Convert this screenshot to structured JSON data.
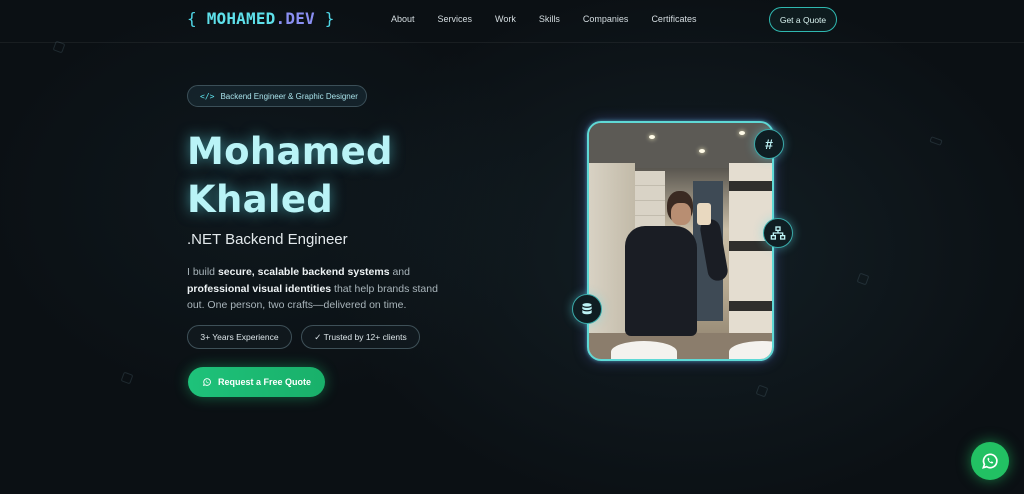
{
  "brand": {
    "open_brace": "{",
    "name": "MOHAMED",
    "suffix": ".DEV",
    "close_brace": "}"
  },
  "nav": {
    "items": [
      "About",
      "Services",
      "Work",
      "Skills",
      "Companies",
      "Certificates"
    ],
    "cta_label": "Get a Quote"
  },
  "hero": {
    "tag": "Backend Engineer & Graphic Designer",
    "first_name": "Mohamed",
    "last_name": "Khaled",
    "role": ".NET Backend Engineer",
    "desc_1": "I build ",
    "desc_bold_1": "secure, scalable backend systems",
    "desc_2": " and ",
    "desc_bold_2": "professional visual identities",
    "desc_3": " that help brands stand out. One person, two crafts—delivered on time.",
    "badges": [
      "3+ Years Experience",
      "✓ Trusted by 12+ clients"
    ],
    "cta_label": "Request a Free Quote"
  },
  "colors": {
    "accent_cyan": "#5ee0ea",
    "accent_violet": "#8a8ff2",
    "cta_green": "#1ec27a",
    "whatsapp_green": "#22c163",
    "background": "#0b1014"
  },
  "icons": {
    "tag": "code-icon",
    "hash": "hash-icon",
    "network": "network-icon",
    "database": "database-icon",
    "cta": "whatsapp-icon",
    "floating": "whatsapp-icon"
  }
}
